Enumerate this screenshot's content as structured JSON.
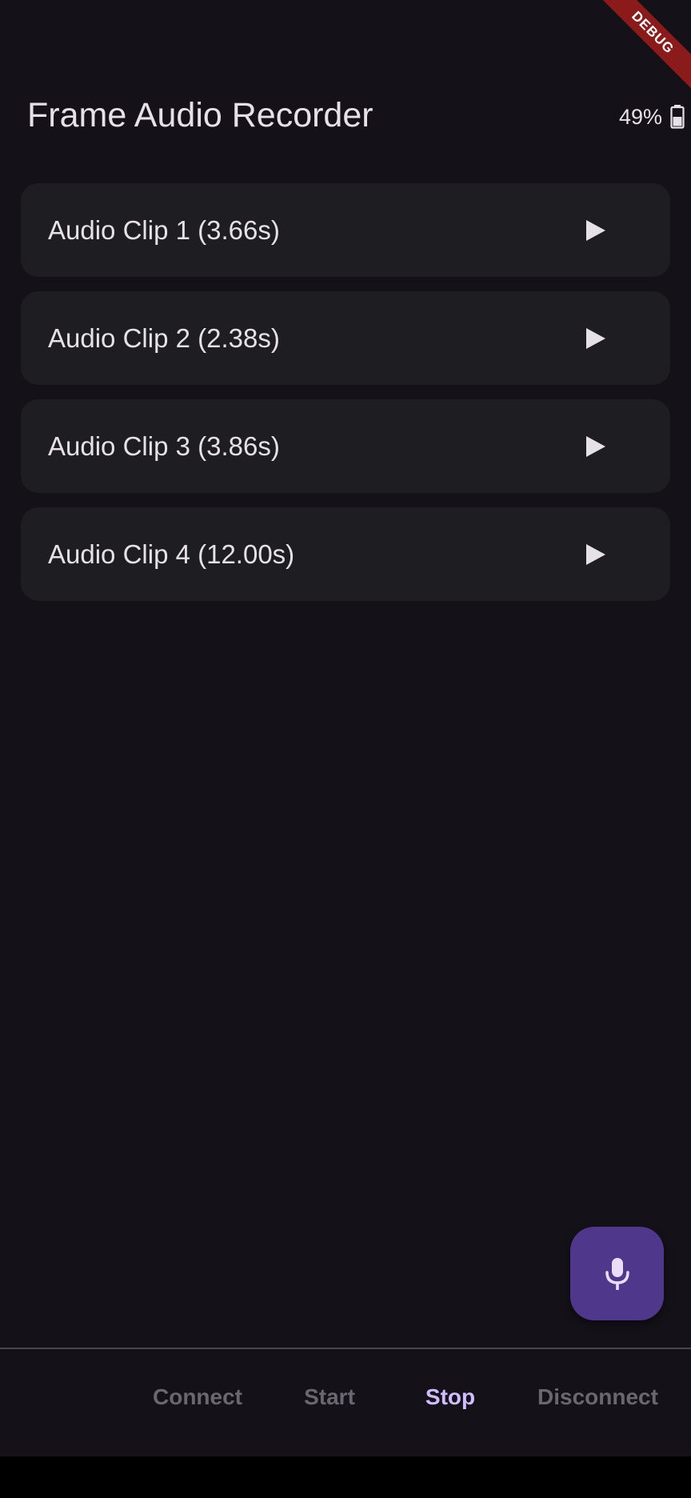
{
  "app": {
    "title": "Frame Audio Recorder",
    "battery_text": "49%",
    "debug_banner": "DEBUG"
  },
  "clips": [
    {
      "label": "Audio Clip 1 (3.66s)",
      "icon": "play-icon"
    },
    {
      "label": "Audio Clip 2 (2.38s)",
      "icon": "play-icon"
    },
    {
      "label": "Audio Clip 3 (3.86s)",
      "icon": "play-icon"
    },
    {
      "label": "Audio Clip 4 (12.00s)",
      "icon": "play-icon"
    }
  ],
  "fab": {
    "icon": "mic-icon"
  },
  "bottom_bar": {
    "connect_label": "Connect",
    "start_label": "Start",
    "stop_label": "Stop",
    "disconnect_label": "Disconnect"
  },
  "colors": {
    "background": "#141218",
    "card": "#1E1D22",
    "accent": "#D0BCFF",
    "fab": "#4F378B",
    "debug": "#8B1A1A"
  }
}
